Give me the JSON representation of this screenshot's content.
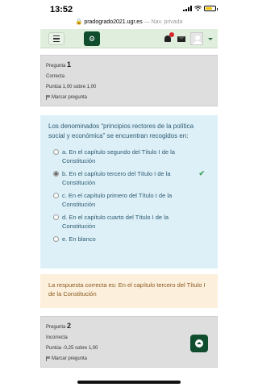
{
  "status": {
    "time": "13:52"
  },
  "browser": {
    "url": "pradogrado2021.ugr.es",
    "separator": "—",
    "mode": "Nav. privada"
  },
  "navbar": {
    "menu_icon": "hamburger-icon",
    "logo_icon": "cogs-icon",
    "accent": "#0f4d2e"
  },
  "question1": {
    "label": "Pregunta",
    "number": "1",
    "state": "Correcta",
    "score": "Puntúa 1,00 sobre 1,00",
    "flag_label": "Marcar pregunta",
    "text": "Los denominados “principios rectores de la política social y económica” se encuentran recogidos en:",
    "answers": [
      {
        "text": "a. En el capítulo segundo del Título I de la Constitución",
        "checked": false
      },
      {
        "text": "b. En el capítulo tercero del Título I de la Constitución",
        "checked": true,
        "mark": "✔"
      },
      {
        "text": "c. En el capítulo primero del Título I de la Constitución",
        "checked": false
      },
      {
        "text": "d. En el capítulo cuarto del Título I de la Constitución",
        "checked": false
      },
      {
        "text": "e. En blanco",
        "checked": false
      }
    ],
    "feedback": "La respuesta correcta es: En el capítulo tercero del Título I de la Constitución"
  },
  "question2": {
    "label": "Pregunta",
    "number": "2",
    "state": "Incorrecta",
    "score": "Puntúa -0,25 sobre 1,00",
    "flag_label": "Marcar pregunta"
  }
}
